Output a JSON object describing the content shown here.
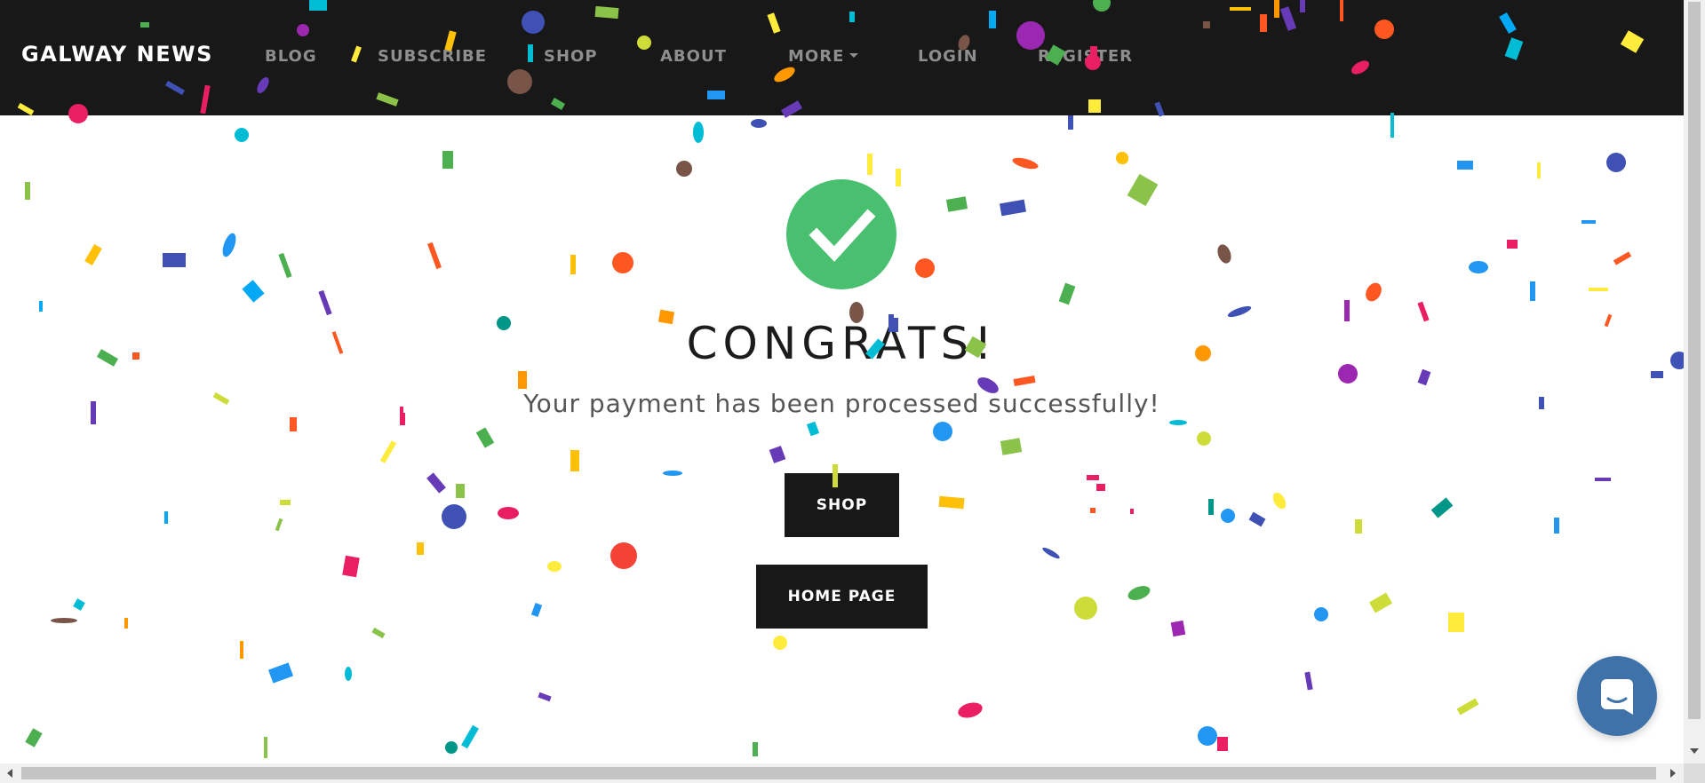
{
  "navbar": {
    "brand": "GALWAY NEWS",
    "items": [
      {
        "label": "BLOG"
      },
      {
        "label": "SUBSCRIBE"
      },
      {
        "label": "SHOP"
      },
      {
        "label": "ABOUT"
      },
      {
        "label": "MORE",
        "dropdown": true
      },
      {
        "label": "LOGIN"
      },
      {
        "label": "REGISTER"
      }
    ]
  },
  "success": {
    "icon": "check-circle-icon",
    "title": "CONGRATS!",
    "message": "Your payment has been processed successfully!"
  },
  "buttons": {
    "shop_label": "SHOP",
    "home_label": "HOME PAGE"
  },
  "chat": {
    "icon": "chat-bubble-icon"
  },
  "colors": {
    "navbar_bg": "#181818",
    "nav_text": "#8e8e8e",
    "success_green": "#48c06f",
    "button_bg": "#181818",
    "chat_blue": "#3f72a8"
  }
}
